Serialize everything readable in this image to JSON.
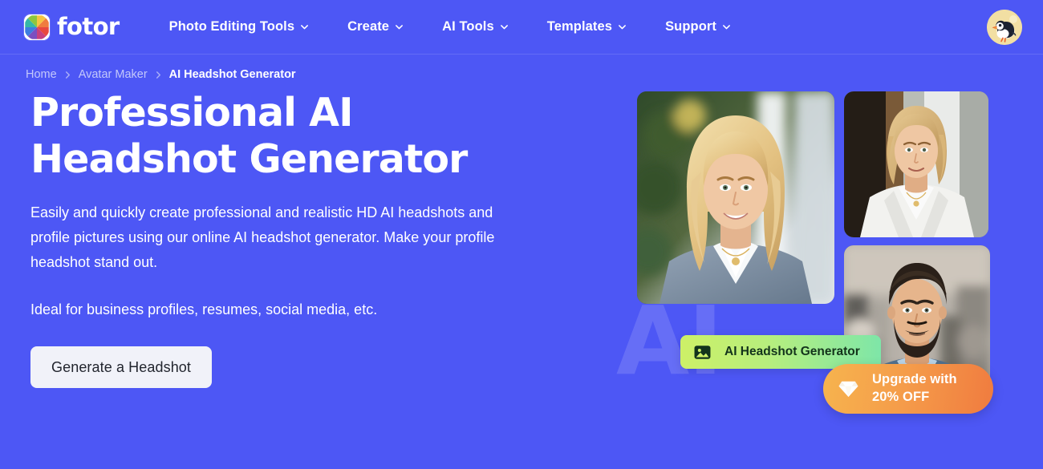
{
  "theme": {
    "background": "#4d57f5",
    "text_on_background": "#ffffff",
    "breadcrumb_muted": "#c3c8fb",
    "cta_background": "#f1f2f9",
    "cta_text": "#22252e",
    "badge_green_from": "#cdf067",
    "badge_green_to": "#7ee6a8",
    "badge_green_text": "#13331b",
    "badge_orange_from": "#f6b44e",
    "badge_orange_to": "#f07b3f",
    "badge_orange_text": "#ffffff"
  },
  "header": {
    "brand": {
      "name": "fotor",
      "logo_icon": "fotor-pinwheel-logo-icon"
    },
    "nav": [
      {
        "label": "Photo Editing Tools",
        "has_dropdown": true,
        "icon": "chevron-down-icon"
      },
      {
        "label": "Create",
        "has_dropdown": true,
        "icon": "chevron-down-icon"
      },
      {
        "label": "AI Tools",
        "has_dropdown": true,
        "icon": "chevron-down-icon"
      },
      {
        "label": "Templates",
        "has_dropdown": true,
        "icon": "chevron-down-icon"
      },
      {
        "label": "Support",
        "has_dropdown": true,
        "icon": "chevron-down-icon"
      }
    ],
    "avatar": {
      "icon": "puffin-bird-avatar-icon",
      "alt": "User avatar"
    }
  },
  "breadcrumb": {
    "separator": "›",
    "items": [
      {
        "label": "Home",
        "current": false
      },
      {
        "label": "Avatar Maker",
        "current": false
      },
      {
        "label": "AI Headshot Generator",
        "current": true
      }
    ]
  },
  "hero": {
    "title": "Professional AI Headshot Generator",
    "description": "Easily and quickly create professional and realistic HD AI headshots and profile pictures using our online AI headshot generator. Make your profile headshot stand out.",
    "description_secondary": "Ideal for business profiles, resumes, social media, etc.",
    "cta_label": "Generate a Headshot",
    "watermark_text": "AI"
  },
  "collage": {
    "photos": [
      {
        "name": "photo-main",
        "alt": "Smiling blonde woman in grey blazer and white shirt, blurred green foliage background"
      },
      {
        "name": "photo-top",
        "alt": "Woman with short blonde bob in white blazer, dark wood and light wall background"
      },
      {
        "name": "photo-bottom",
        "alt": "Bearded man in blue blazer and light blue shirt, blurred street background"
      }
    ],
    "badges": {
      "generator": {
        "label": "AI Headshot Generator",
        "icon": "image-photo-icon"
      },
      "upgrade": {
        "line1": "Upgrade with",
        "line2": "20% OFF",
        "icon": "diamond-gem-icon"
      }
    }
  }
}
